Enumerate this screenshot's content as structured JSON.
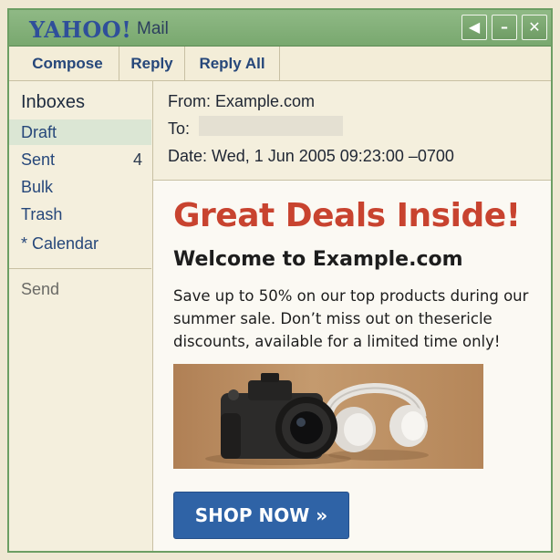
{
  "window": {
    "logo": "YAHOO!",
    "app_name": "Mail",
    "buttons": {
      "back": "◀",
      "minimize": "–",
      "close": "✕"
    }
  },
  "toolbar": {
    "compose_label": "Compose",
    "reply_label": "Reply",
    "reply_all_label": "Reply All"
  },
  "sidebar": {
    "heading": "Inboxes",
    "items": [
      {
        "label": "Draft",
        "count": "",
        "active": true
      },
      {
        "label": "Sent",
        "count": "4",
        "active": false
      },
      {
        "label": "Bulk",
        "count": "",
        "active": false
      },
      {
        "label": "Trash",
        "count": "",
        "active": false
      },
      {
        "label": "* Calendar",
        "count": "",
        "active": false
      }
    ],
    "send_label": "Send"
  },
  "header": {
    "from": "From: Example.com",
    "to": "To:",
    "date": "Date: Wed, 1 Jun 2005 09:23:00 –0700"
  },
  "message": {
    "headline": "Great Deals Inside!",
    "subhead": "Welcome to Example.com",
    "body": "Save up to 50% on our top products during our summer sale. Don’t miss out on thesericle discounts, available for a limited time only!",
    "cta_label": "SHOP NOW »"
  },
  "colors": {
    "frame": "#6c9e63",
    "title_bar": "#79a86f",
    "link": "#26477a",
    "headline": "#c8432f",
    "cta": "#2f63a6"
  }
}
